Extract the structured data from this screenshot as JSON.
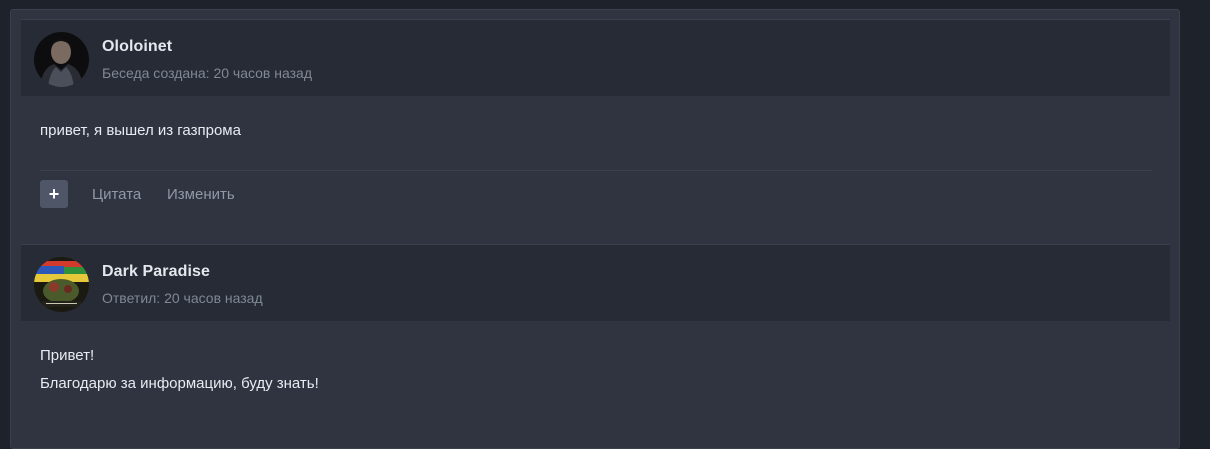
{
  "messages": [
    {
      "author": "Ololoinet",
      "meta": "Беседа создана: 20 часов назад",
      "avatar_icon": "man-in-black-suit-avatar",
      "lines": [
        "привет, я вышел из газпрома"
      ],
      "actions": {
        "react": "+",
        "quote": "Цитата",
        "edit": "Изменить"
      }
    },
    {
      "author": "Dark Paradise",
      "meta": "Ответил: 20 часов назад",
      "avatar_icon": "flag-collage-avatar",
      "lines": [
        "Привет!",
        "Благодарю за информацию, буду знать!"
      ]
    }
  ],
  "colors": {
    "page_bg": "#1e222b",
    "panel_bg": "#2f3440",
    "header_bg": "#272b35",
    "button_bg": "#4e5667"
  }
}
